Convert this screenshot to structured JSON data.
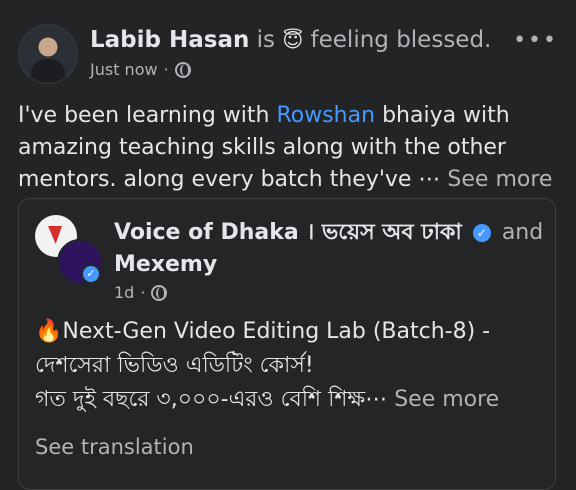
{
  "post": {
    "author": "Labib Hasan",
    "is_text": "is",
    "feeling_emoji": "😇",
    "feeling_text": "feeling blessed.",
    "time": "Just now",
    "separator": "·",
    "more_icon": "•••",
    "body_prefix": "I've been learning with ",
    "mention": "Rowshan",
    "body_suffix": " bhaiya with amazing teaching skills along with the other mentors. along every batch they've ⋯ ",
    "see_more": "See more"
  },
  "shared": {
    "page_name": "Voice of Dhaka । ভয়েস অব ঢাকা",
    "verified_icon": "✓",
    "and_text": "and",
    "second_page": "Mexemy",
    "time": "1d",
    "separator": "·",
    "line1": "🔥Next-Gen Video Editing Lab (Batch-8) -",
    "line2": "দেশসেরা ভিডিও এডিটিং কোর্স!",
    "line3": "গত দুই বছরে ৩,০০০-এরও বেশি শিক্ষ⋯ ",
    "see_more": "See more",
    "see_translation": "See translation"
  }
}
